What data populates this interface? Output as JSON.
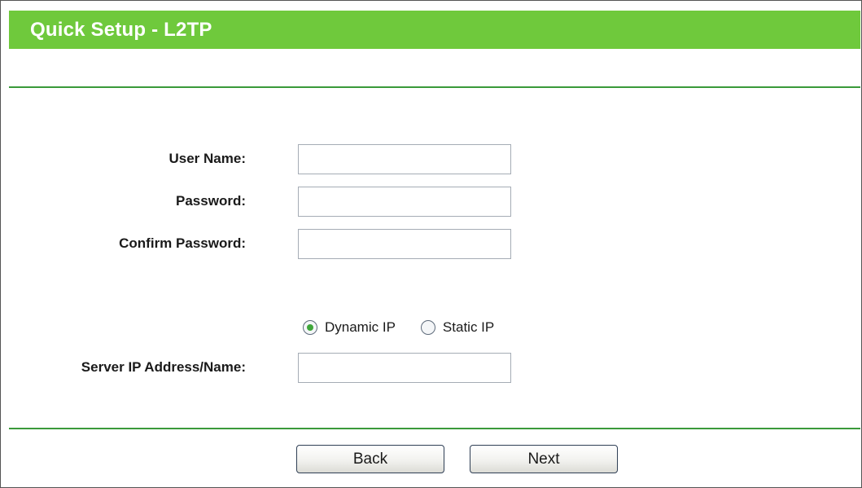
{
  "header": {
    "title": "Quick Setup - L2TP"
  },
  "form": {
    "user_name": {
      "label": "User Name:",
      "value": ""
    },
    "password": {
      "label": "Password:",
      "value": ""
    },
    "confirm_password": {
      "label": "Confirm Password:",
      "value": ""
    },
    "ip_mode": {
      "options": [
        "Dynamic IP",
        "Static IP"
      ],
      "selected": "Dynamic IP"
    },
    "server": {
      "label": "Server IP Address/Name:",
      "value": ""
    }
  },
  "buttons": {
    "back_label": "Back",
    "next_label": "Next"
  },
  "colors": {
    "title_bar": "#6fc93c",
    "divider": "#3a9a3a",
    "radio_dot": "#3fa63a"
  }
}
